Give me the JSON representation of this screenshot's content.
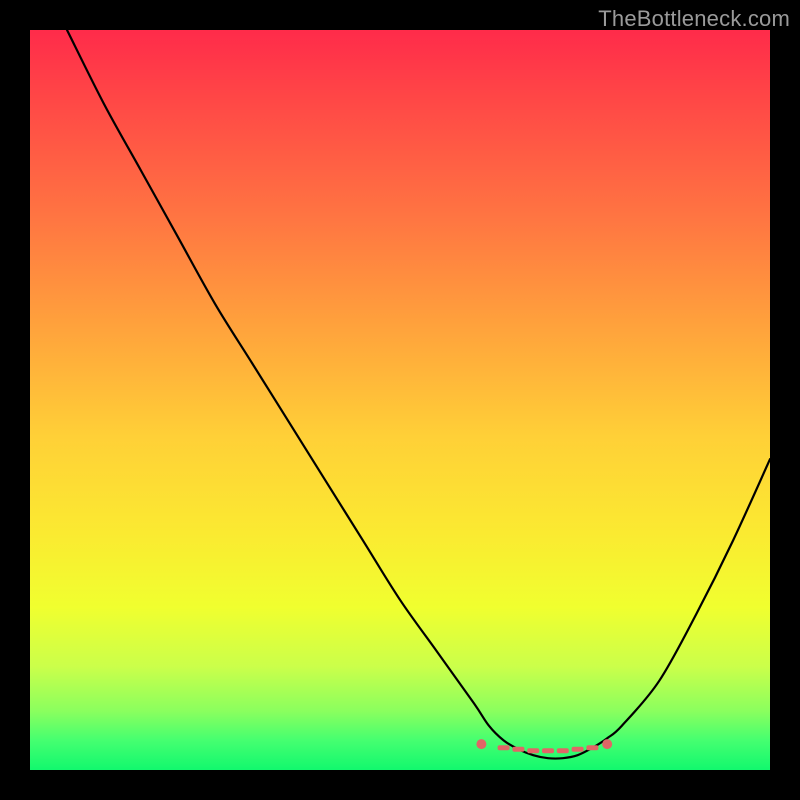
{
  "watermark": "TheBottleneck.com",
  "chart_data": {
    "type": "line",
    "title": "",
    "xlabel": "",
    "ylabel": "",
    "xlim": [
      0,
      100
    ],
    "ylim": [
      0,
      100
    ],
    "grid": false,
    "legend": false,
    "series": [
      {
        "name": "bottleneck-curve",
        "color": "#000000",
        "x": [
          5,
          10,
          15,
          20,
          25,
          30,
          35,
          40,
          45,
          50,
          55,
          60,
          62,
          64,
          66,
          68,
          70,
          72,
          74,
          76,
          78,
          80,
          85,
          90,
          95,
          100
        ],
        "values": [
          100,
          90,
          81,
          72,
          63,
          55,
          47,
          39,
          31,
          23,
          16,
          9,
          6,
          4,
          2.8,
          2,
          1.6,
          1.6,
          2,
          3,
          4.3,
          6,
          12,
          21,
          31,
          42
        ]
      },
      {
        "name": "optimal-band-markers",
        "color": "#e06666",
        "x": [
          61,
          64,
          66,
          68,
          70,
          72,
          74,
          76,
          78
        ],
        "values": [
          3.5,
          3,
          2.8,
          2.6,
          2.6,
          2.6,
          2.8,
          3,
          3.5
        ]
      }
    ]
  }
}
